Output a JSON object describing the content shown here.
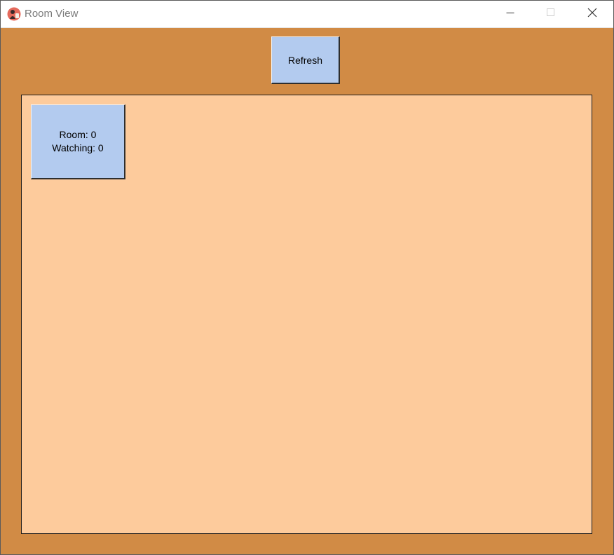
{
  "window": {
    "title": "Room View",
    "icon": "app-logo-icon",
    "controls": {
      "minimize_icon": "minimize-icon",
      "maximize_icon": "maximize-icon",
      "close_icon": "close-icon"
    }
  },
  "toolbar": {
    "refresh_label": "Refresh"
  },
  "rooms": [
    {
      "room_label": "Room: 0",
      "watching_label": "Watching: 0"
    }
  ],
  "colors": {
    "background": "#d18b45",
    "panel": "#fdcb9c",
    "button": "#b3cbef"
  }
}
